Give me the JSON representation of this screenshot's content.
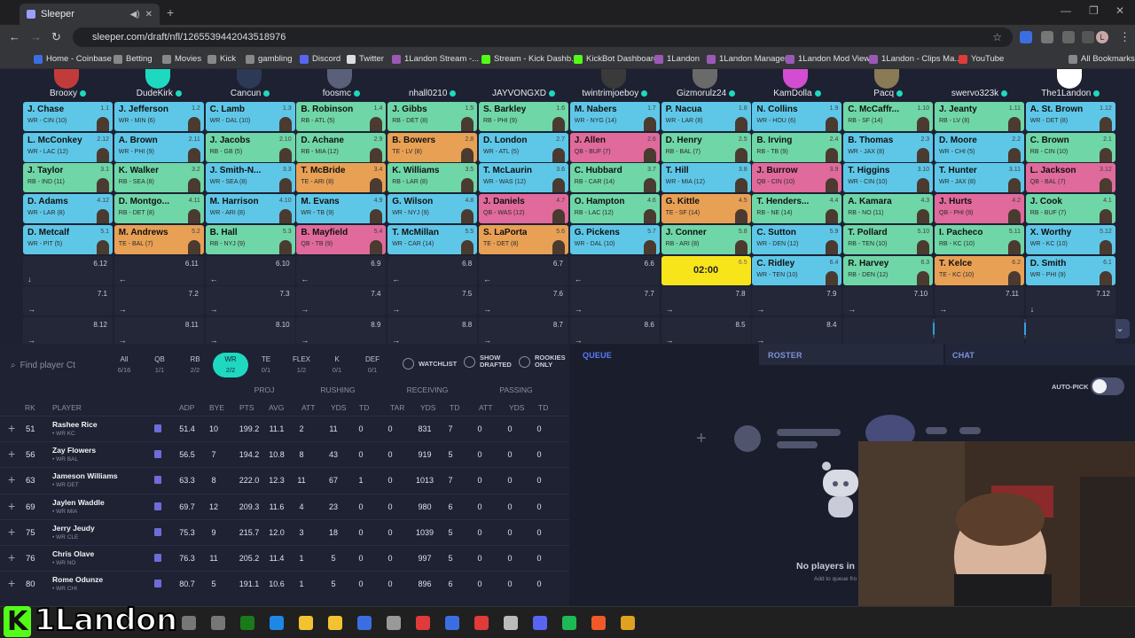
{
  "browser": {
    "tab_title": "Sleeper",
    "url": "sleeper.com/draft/nfl/1265539442043518976",
    "profile_letter": "L",
    "bookmarks": [
      "Home - Coinbase",
      "Betting",
      "Movies",
      "Kick",
      "gambling",
      "Discord",
      "Twitter",
      "1Landon Stream -...",
      "Stream - Kick Dashb...",
      "KickBot Dashboard",
      "1Landon",
      "1Landon Manager",
      "1Landon Mod View",
      "1Landon - Clips Ma...",
      "YouTube",
      "All Bookmarks"
    ]
  },
  "teams": [
    "Brooxy",
    "DudeKirk",
    "Cancun",
    "foosmc",
    "nhall0210",
    "JAYVONGXD",
    "twintrimjoeboy",
    "Gizmorulz24",
    "KamDolla",
    "Pacq",
    "swervo323k",
    "The1Landon"
  ],
  "team_avatar_colors": [
    "#c23b3b",
    "#1ed9c0",
    "#2c3a55",
    "#5a5f7a",
    "#1d2131",
    "#1d2131",
    "#3a3a3a",
    "#6a6a6a",
    "#d24dd1",
    "#8a7a55",
    "#1d2131",
    "#ffffff"
  ],
  "colors": {
    "WR": "#5ec7e8",
    "RB": "#6fd6a7",
    "TE": "#e8a055",
    "QB": "#e06a9b",
    "clock": "#f8e41b",
    "accent": "#1ed9c0",
    "note": "#6f6bd9"
  },
  "board": [
    [
      {
        "name": "J. Chase",
        "detail": "WR - CIN (10)",
        "pick": "1.1",
        "pos": "WR"
      },
      {
        "name": "J. Jefferson",
        "detail": "WR - MIN (6)",
        "pick": "1.2",
        "pos": "WR"
      },
      {
        "name": "C. Lamb",
        "detail": "WR - DAL (10)",
        "pick": "1.3",
        "pos": "WR"
      },
      {
        "name": "B. Robinson",
        "detail": "RB - ATL (5)",
        "pick": "1.4",
        "pos": "RB"
      },
      {
        "name": "J. Gibbs",
        "detail": "RB - DET (8)",
        "pick": "1.5",
        "pos": "RB"
      },
      {
        "name": "S. Barkley",
        "detail": "RB - PHI (9)",
        "pick": "1.6",
        "pos": "RB"
      },
      {
        "name": "M. Nabers",
        "detail": "WR - NYG (14)",
        "pick": "1.7",
        "pos": "WR"
      },
      {
        "name": "P. Nacua",
        "detail": "WR - LAR (8)",
        "pick": "1.8",
        "pos": "WR"
      },
      {
        "name": "N. Collins",
        "detail": "WR - HOU (6)",
        "pick": "1.9",
        "pos": "WR"
      },
      {
        "name": "C. McCaffr...",
        "detail": "RB - SF (14)",
        "pick": "1.10",
        "pos": "RB"
      },
      {
        "name": "J. Jeanty",
        "detail": "RB - LV (8)",
        "pick": "1.11",
        "pos": "RB"
      },
      {
        "name": "A. St. Brown",
        "detail": "WR - DET (8)",
        "pick": "1.12",
        "pos": "WR"
      }
    ],
    [
      {
        "name": "L. McConkey",
        "detail": "WR - LAC (12)",
        "pick": "2.12",
        "pos": "WR"
      },
      {
        "name": "A. Brown",
        "detail": "WR - PHI (9)",
        "pick": "2.11",
        "pos": "WR"
      },
      {
        "name": "J. Jacobs",
        "detail": "RB - GB (5)",
        "pick": "2.10",
        "pos": "RB"
      },
      {
        "name": "D. Achane",
        "detail": "RB - MIA (12)",
        "pick": "2.9",
        "pos": "RB"
      },
      {
        "name": "B. Bowers",
        "detail": "TE - LV (8)",
        "pick": "2.8",
        "pos": "TE"
      },
      {
        "name": "D. London",
        "detail": "WR - ATL (5)",
        "pick": "2.7",
        "pos": "WR"
      },
      {
        "name": "J. Allen",
        "detail": "QB - BUF (7)",
        "pick": "2.6",
        "pos": "QB"
      },
      {
        "name": "D. Henry",
        "detail": "RB - BAL (7)",
        "pick": "2.5",
        "pos": "RB"
      },
      {
        "name": "B. Irving",
        "detail": "RB - TB (9)",
        "pick": "2.4",
        "pos": "RB"
      },
      {
        "name": "B. Thomas",
        "detail": "WR - JAX (8)",
        "pick": "2.3",
        "pos": "WR"
      },
      {
        "name": "D. Moore",
        "detail": "WR - CHI (5)",
        "pick": "2.2",
        "pos": "WR"
      },
      {
        "name": "C. Brown",
        "detail": "RB - CIN (10)",
        "pick": "2.1",
        "pos": "RB"
      }
    ],
    [
      {
        "name": "J. Taylor",
        "detail": "RB - IND (11)",
        "pick": "3.1",
        "pos": "RB"
      },
      {
        "name": "K. Walker",
        "detail": "RB - SEA (8)",
        "pick": "3.2",
        "pos": "RB"
      },
      {
        "name": "J. Smith-N...",
        "detail": "WR - SEA (8)",
        "pick": "3.3",
        "pos": "WR"
      },
      {
        "name": "T. McBride",
        "detail": "TE - ARI (8)",
        "pick": "3.4",
        "pos": "TE"
      },
      {
        "name": "K. Williams",
        "detail": "RB - LAR (8)",
        "pick": "3.5",
        "pos": "RB"
      },
      {
        "name": "T. McLaurin",
        "detail": "WR - WAS (12)",
        "pick": "3.6",
        "pos": "WR"
      },
      {
        "name": "C. Hubbard",
        "detail": "RB - CAR (14)",
        "pick": "3.7",
        "pos": "RB"
      },
      {
        "name": "T. Hill",
        "detail": "WR - MIA (12)",
        "pick": "3.8",
        "pos": "WR"
      },
      {
        "name": "J. Burrow",
        "detail": "QB - CIN (10)",
        "pick": "3.9",
        "pos": "QB"
      },
      {
        "name": "T. Higgins",
        "detail": "WR - CIN (10)",
        "pick": "3.10",
        "pos": "WR"
      },
      {
        "name": "T. Hunter",
        "detail": "WR - JAX (8)",
        "pick": "3.11",
        "pos": "WR"
      },
      {
        "name": "L. Jackson",
        "detail": "QB - BAL (7)",
        "pick": "3.12",
        "pos": "QB"
      }
    ],
    [
      {
        "name": "D. Adams",
        "detail": "WR - LAR (8)",
        "pick": "4.12",
        "pos": "WR"
      },
      {
        "name": "D. Montgo...",
        "detail": "RB - DET (8)",
        "pick": "4.11",
        "pos": "RB"
      },
      {
        "name": "M. Harrison",
        "detail": "WR - ARI (8)",
        "pick": "4.10",
        "pos": "WR"
      },
      {
        "name": "M. Evans",
        "detail": "WR - TB (9)",
        "pick": "4.9",
        "pos": "WR"
      },
      {
        "name": "G. Wilson",
        "detail": "WR - NYJ (9)",
        "pick": "4.8",
        "pos": "WR"
      },
      {
        "name": "J. Daniels",
        "detail": "QB - WAS (12)",
        "pick": "4.7",
        "pos": "QB"
      },
      {
        "name": "O. Hampton",
        "detail": "RB - LAC (12)",
        "pick": "4.6",
        "pos": "RB"
      },
      {
        "name": "G. Kittle",
        "detail": "TE - SF (14)",
        "pick": "4.5",
        "pos": "TE"
      },
      {
        "name": "T. Henders...",
        "detail": "RB - NE (14)",
        "pick": "4.4",
        "pos": "RB"
      },
      {
        "name": "A. Kamara",
        "detail": "RB - NO (11)",
        "pick": "4.3",
        "pos": "RB"
      },
      {
        "name": "J. Hurts",
        "detail": "QB - PHI (9)",
        "pick": "4.2",
        "pos": "QB"
      },
      {
        "name": "J. Cook",
        "detail": "RB - BUF (7)",
        "pick": "4.1",
        "pos": "RB"
      }
    ],
    [
      {
        "name": "D. Metcalf",
        "detail": "WR - PIT (5)",
        "pick": "5.1",
        "pos": "WR"
      },
      {
        "name": "M. Andrews",
        "detail": "TE - BAL (7)",
        "pick": "5.2",
        "pos": "TE"
      },
      {
        "name": "B. Hall",
        "detail": "RB - NYJ (9)",
        "pick": "5.3",
        "pos": "RB"
      },
      {
        "name": "B. Mayfield",
        "detail": "QB - TB (9)",
        "pick": "5.4",
        "pos": "QB"
      },
      {
        "name": "T. McMillan",
        "detail": "WR - CAR (14)",
        "pick": "5.5",
        "pos": "WR"
      },
      {
        "name": "S. LaPorta",
        "detail": "TE - DET (8)",
        "pick": "5.6",
        "pos": "TE"
      },
      {
        "name": "G. Pickens",
        "detail": "WR - DAL (10)",
        "pick": "5.7",
        "pos": "WR"
      },
      {
        "name": "J. Conner",
        "detail": "RB - ARI (8)",
        "pick": "5.8",
        "pos": "RB"
      },
      {
        "name": "C. Sutton",
        "detail": "WR - DEN (12)",
        "pick": "5.9",
        "pos": "WR"
      },
      {
        "name": "T. Pollard",
        "detail": "RB - TEN (10)",
        "pick": "5.10",
        "pos": "RB"
      },
      {
        "name": "I. Pacheco",
        "detail": "RB - KC (10)",
        "pick": "5.11",
        "pos": "RB"
      },
      {
        "name": "X. Worthy",
        "detail": "WR - KC (10)",
        "pick": "5.12",
        "pos": "WR"
      }
    ],
    [
      {
        "pick": "6.12",
        "arrow": "↓"
      },
      {
        "pick": "6.11",
        "arrow": "←"
      },
      {
        "pick": "6.10",
        "arrow": "←"
      },
      {
        "pick": "6.9",
        "arrow": "←"
      },
      {
        "pick": "6.8",
        "arrow": "←"
      },
      {
        "pick": "6.7",
        "arrow": "←"
      },
      {
        "pick": "6.6",
        "arrow": "←"
      },
      {
        "pick": "6.5",
        "clock": "02:00"
      },
      {
        "name": "C. Ridley",
        "detail": "WR - TEN (10)",
        "pick": "6.4",
        "pos": "WR"
      },
      {
        "name": "R. Harvey",
        "detail": "RB - DEN (12)",
        "pick": "6.3",
        "pos": "RB"
      },
      {
        "name": "T. Kelce",
        "detail": "TE - KC (10)",
        "pick": "6.2",
        "pos": "TE"
      },
      {
        "name": "D. Smith",
        "detail": "WR - PHI (9)",
        "pick": "6.1",
        "pos": "WR"
      }
    ],
    [
      {
        "pick": "7.1",
        "arrow": "→"
      },
      {
        "pick": "7.2",
        "arrow": "→"
      },
      {
        "pick": "7.3",
        "arrow": "→"
      },
      {
        "pick": "7.4",
        "arrow": "→"
      },
      {
        "pick": "7.5",
        "arrow": "→"
      },
      {
        "pick": "7.6",
        "arrow": "→"
      },
      {
        "pick": "7.7",
        "arrow": "→"
      },
      {
        "pick": "7.8",
        "arrow": "→"
      },
      {
        "pick": "7.9",
        "arrow": "→"
      },
      {
        "pick": "7.10",
        "arrow": "→"
      },
      {
        "pick": "7.11",
        "arrow": "→"
      },
      {
        "pick": "7.12",
        "arrow": "↓"
      }
    ],
    [
      {
        "pick": "8.12",
        "arrow": "→"
      },
      {
        "pick": "8.11",
        "arrow": "→"
      },
      {
        "pick": "8.10",
        "arrow": "→"
      },
      {
        "pick": "8.9",
        "arrow": "→"
      },
      {
        "pick": "8.8",
        "arrow": "→"
      },
      {
        "pick": "8.7",
        "arrow": "→"
      },
      {
        "pick": "8.6",
        "arrow": "→"
      },
      {
        "pick": "8.5",
        "arrow": "→"
      },
      {
        "pick": "8.4",
        "arrow": "→"
      },
      {
        "pick": "",
        "arrow": ""
      },
      {
        "pick": "",
        "arrow": ""
      },
      {
        "pick": "",
        "arrow": ""
      }
    ]
  ],
  "emojis": [
    "#e0453a",
    "#c66b3a",
    "#3a80e0",
    "#2f9fd0",
    "#f2c230",
    "#e03a3a",
    "#4a6ad0",
    "#f2d020",
    "#3aa0e0",
    "#d8dae4",
    "#c9ccd8"
  ],
  "player_panel": {
    "search_placeholder": "Find player Ct",
    "filters": [
      {
        "label": "All",
        "count": "6/16"
      },
      {
        "label": "QB",
        "count": "1/1"
      },
      {
        "label": "RB",
        "count": "2/2"
      },
      {
        "label": "WR",
        "count": "2/2",
        "active": true
      },
      {
        "label": "TE",
        "count": "0/1"
      },
      {
        "label": "FLEX",
        "count": "1/2"
      },
      {
        "label": "K",
        "count": "0/1"
      },
      {
        "label": "DEF",
        "count": "0/1"
      }
    ],
    "watchlist": "WATCHLIST",
    "show_drafted": "SHOW DRAFTED",
    "rookies_only": "ROOKIES ONLY",
    "groups": [
      "PROJ",
      "RUSHING",
      "RECEIVING",
      "PASSING"
    ],
    "columns": [
      "RK",
      "PLAYER",
      "ADP",
      "BYE",
      "PTS",
      "AVG",
      "ATT",
      "YDS",
      "TD",
      "TAR",
      "YDS",
      "TD",
      "ATT",
      "YDS",
      "TD"
    ],
    "players": [
      {
        "rk": "51",
        "name": "Rashee Rice",
        "sub": "• WR KC",
        "adp": "51.4",
        "bye": "10",
        "pts": "199.2",
        "avg": "11.1",
        "ratt": "2",
        "ryds": "11",
        "rtd": "0",
        "tar": "0",
        "cyds": "831",
        "ctd": "7",
        "patt": "0",
        "pyds": "0",
        "ptd": "0"
      },
      {
        "rk": "56",
        "name": "Zay Flowers",
        "sub": "• WR BAL",
        "adp": "56.5",
        "bye": "7",
        "pts": "194.2",
        "avg": "10.8",
        "ratt": "8",
        "ryds": "43",
        "rtd": "0",
        "tar": "0",
        "cyds": "919",
        "ctd": "5",
        "patt": "0",
        "pyds": "0",
        "ptd": "0"
      },
      {
        "rk": "63",
        "name": "Jameson Williams",
        "sub": "• WR DET",
        "adp": "63.3",
        "bye": "8",
        "pts": "222.0",
        "avg": "12.3",
        "ratt": "11",
        "ryds": "67",
        "rtd": "1",
        "tar": "0",
        "cyds": "1013",
        "ctd": "7",
        "patt": "0",
        "pyds": "0",
        "ptd": "0"
      },
      {
        "rk": "69",
        "name": "Jaylen Waddle",
        "sub": "• WR MIA",
        "adp": "69.7",
        "bye": "12",
        "pts": "209.3",
        "avg": "11.6",
        "ratt": "4",
        "ryds": "23",
        "rtd": "0",
        "tar": "0",
        "cyds": "980",
        "ctd": "6",
        "patt": "0",
        "pyds": "0",
        "ptd": "0"
      },
      {
        "rk": "75",
        "name": "Jerry Jeudy",
        "sub": "• WR CLE",
        "adp": "75.3",
        "bye": "9",
        "pts": "215.7",
        "avg": "12.0",
        "ratt": "3",
        "ryds": "18",
        "rtd": "0",
        "tar": "0",
        "cyds": "1039",
        "ctd": "5",
        "patt": "0",
        "pyds": "0",
        "ptd": "0"
      },
      {
        "rk": "76",
        "name": "Chris Olave",
        "sub": "• WR NO",
        "adp": "76.3",
        "bye": "11",
        "pts": "205.2",
        "avg": "11.4",
        "ratt": "1",
        "ryds": "5",
        "rtd": "0",
        "tar": "0",
        "cyds": "997",
        "ctd": "5",
        "patt": "0",
        "pyds": "0",
        "ptd": "0"
      },
      {
        "rk": "80",
        "name": "Rome Odunze",
        "sub": "• WR CHI",
        "adp": "80.7",
        "bye": "5",
        "pts": "191.1",
        "avg": "10.6",
        "ratt": "1",
        "ryds": "5",
        "rtd": "0",
        "tar": "0",
        "cyds": "896",
        "ctd": "6",
        "patt": "0",
        "pyds": "0",
        "ptd": "0"
      }
    ]
  },
  "queue": {
    "title": "QUEUE",
    "roster_tab": "ROSTER",
    "chat_tab": "CHAT",
    "autopick": "AUTO-PICK",
    "empty_title": "No players in",
    "empty_sub": "Add to queue fro"
  },
  "overlay": {
    "logo_text": "1Landon"
  }
}
